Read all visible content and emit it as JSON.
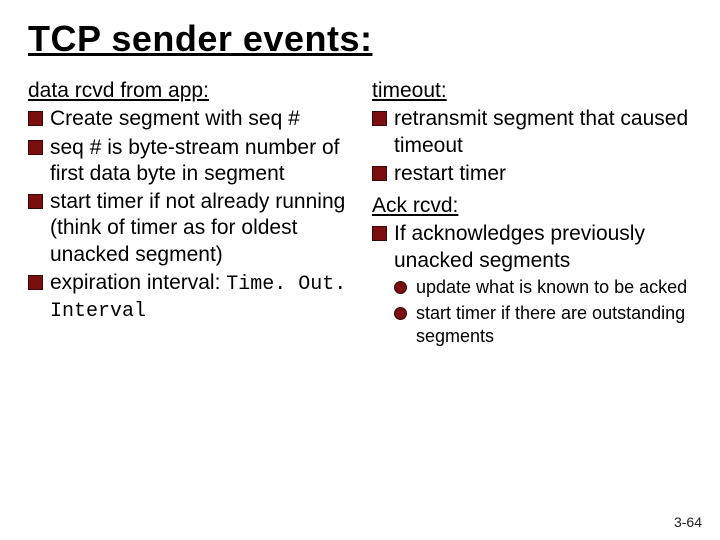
{
  "title": "TCP sender events:",
  "left": {
    "heading": "data rcvd from app:",
    "items": [
      "Create segment with seq #",
      "seq # is byte-stream number of first data byte in  segment",
      "start timer if not already running (think of timer as for oldest unacked segment)",
      "expiration interval: "
    ],
    "code_tail": "Time. Out. Interval"
  },
  "right": {
    "heading1": "timeout:",
    "items1": [
      "retransmit segment that caused timeout",
      "restart timer"
    ],
    "heading2": "Ack rcvd:",
    "items2": [
      "If acknowledges previously unacked segments"
    ],
    "subitems": [
      "update what is known to be acked",
      "start timer if there are outstanding segments"
    ]
  },
  "pagenum": "3-64"
}
